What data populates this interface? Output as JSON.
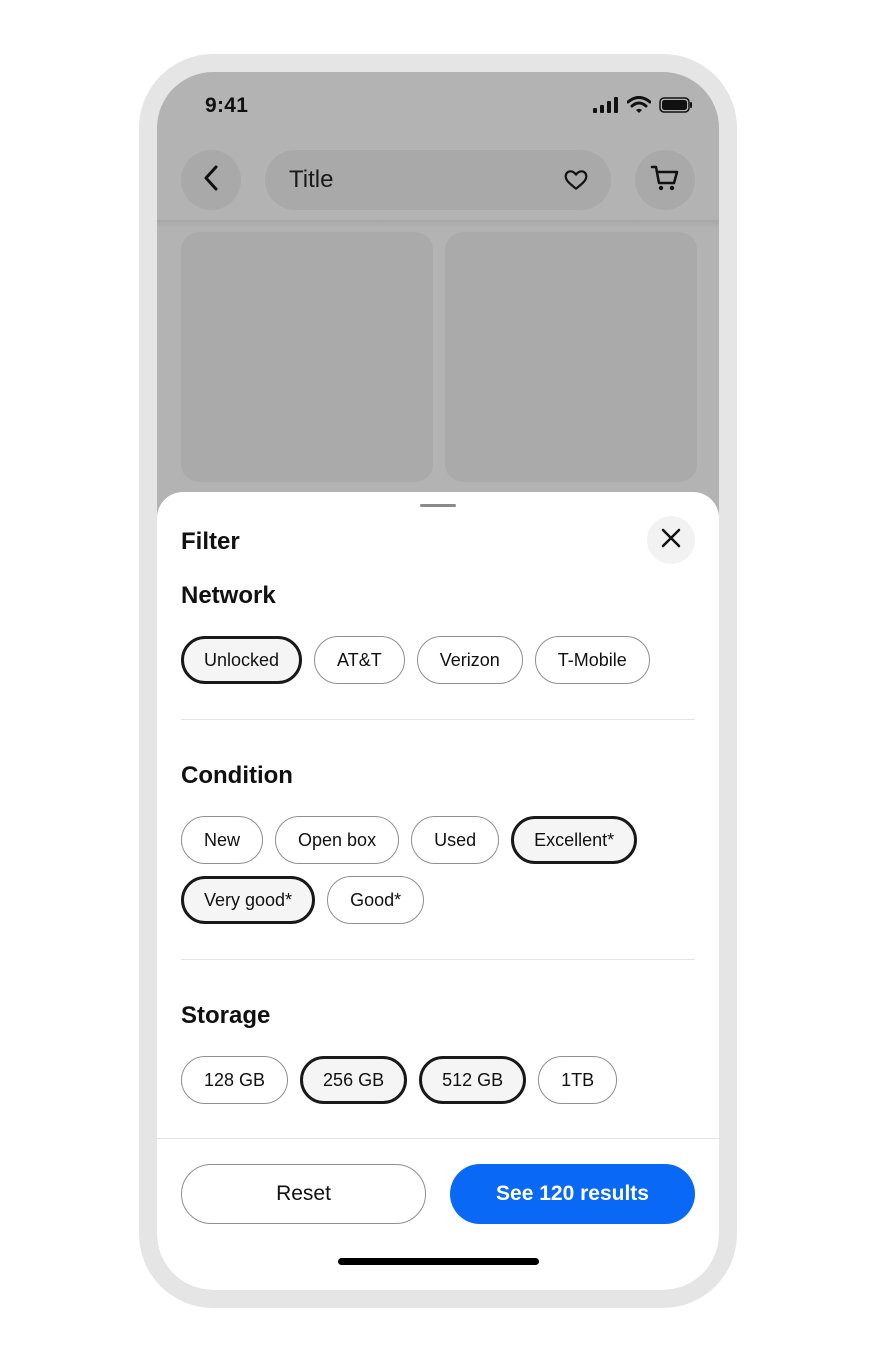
{
  "status_bar": {
    "time": "9:41"
  },
  "nav": {
    "title": "Title"
  },
  "filter": {
    "title": "Filter",
    "sections": [
      {
        "title": "Network",
        "chips": [
          {
            "label": "Unlocked",
            "selected": true
          },
          {
            "label": "AT&T",
            "selected": false
          },
          {
            "label": "Verizon",
            "selected": false
          },
          {
            "label": "T-Mobile",
            "selected": false
          }
        ]
      },
      {
        "title": "Condition",
        "chips": [
          {
            "label": "New",
            "selected": false
          },
          {
            "label": "Open box",
            "selected": false
          },
          {
            "label": "Used",
            "selected": false
          },
          {
            "label": "Excellent*",
            "selected": true
          },
          {
            "label": "Very good*",
            "selected": true
          },
          {
            "label": "Good*",
            "selected": false
          }
        ]
      },
      {
        "title": "Storage",
        "chips": [
          {
            "label": "128 GB",
            "selected": false
          },
          {
            "label": "256 GB",
            "selected": true
          },
          {
            "label": "512 GB",
            "selected": true
          },
          {
            "label": "1TB",
            "selected": false
          }
        ]
      }
    ],
    "reset_label": "Reset",
    "results_label": "See 120 results"
  },
  "icons": {
    "back": "chevron-left-icon",
    "favorite": "heart-icon",
    "cart": "cart-icon",
    "close": "close-icon",
    "signal": "cellular-signal-icon",
    "wifi": "wifi-icon",
    "battery": "battery-icon"
  },
  "colors": {
    "primary": "#0968f6",
    "selected_border": "#191919",
    "scrim": "#b3b3b3"
  }
}
